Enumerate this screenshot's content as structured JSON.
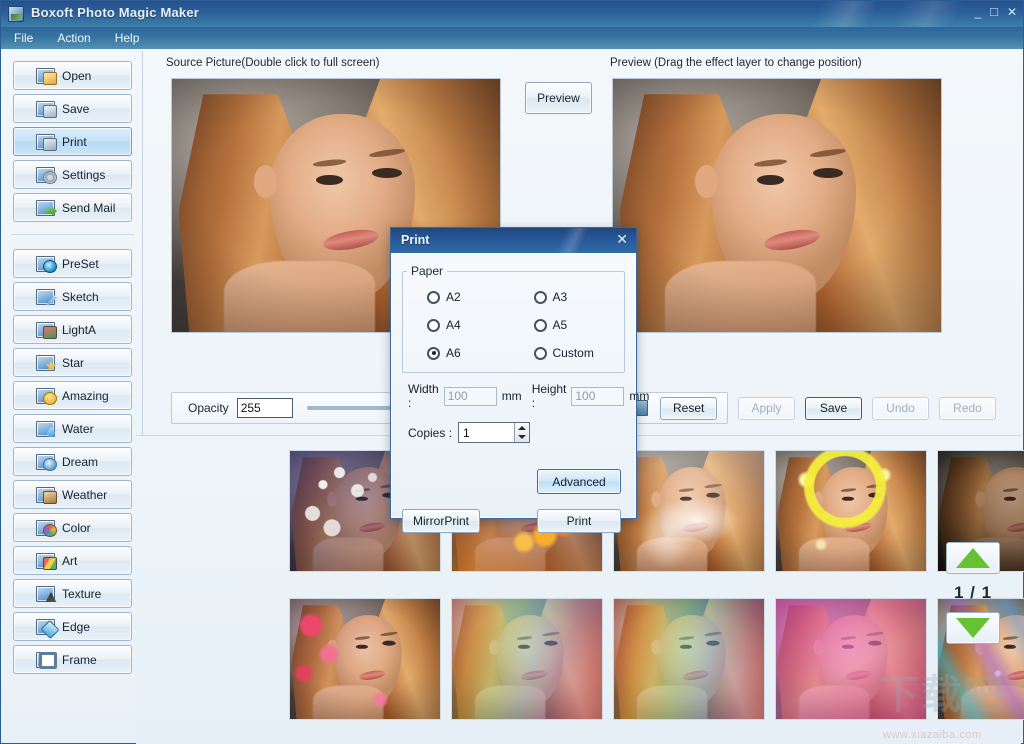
{
  "window": {
    "title": "Boxoft Photo Magic Maker",
    "icon": "app-icon",
    "minimize": "_",
    "maximize": "□",
    "close": "✕"
  },
  "menubar": {
    "items": [
      {
        "label": "File"
      },
      {
        "label": "Action"
      },
      {
        "label": "Help"
      }
    ]
  },
  "sidebar": {
    "group1": [
      {
        "label": "Open",
        "icon": "open-icon",
        "active": false
      },
      {
        "label": "Save",
        "icon": "save-icon",
        "active": false
      },
      {
        "label": "Print",
        "icon": "print-icon",
        "active": true
      },
      {
        "label": "Settings",
        "icon": "settings-icon",
        "active": false
      },
      {
        "label": "Send Mail",
        "icon": "mail-icon",
        "active": false
      }
    ],
    "group2": [
      {
        "label": "PreSet",
        "icon": "preset-icon"
      },
      {
        "label": "Sketch",
        "icon": "sketch-icon"
      },
      {
        "label": "LightA",
        "icon": "lighta-icon"
      },
      {
        "label": "Star",
        "icon": "star-icon"
      },
      {
        "label": "Amazing",
        "icon": "amazing-icon"
      },
      {
        "label": "Water",
        "icon": "water-icon"
      },
      {
        "label": "Dream",
        "icon": "dream-icon"
      },
      {
        "label": "Weather",
        "icon": "weather-icon"
      },
      {
        "label": "Color",
        "icon": "color-icon"
      },
      {
        "label": "Art",
        "icon": "art-icon"
      },
      {
        "label": "Texture",
        "icon": "texture-icon"
      },
      {
        "label": "Edge",
        "icon": "edge-icon"
      },
      {
        "label": "Frame",
        "icon": "frame-icon"
      }
    ]
  },
  "main": {
    "source_label": "Source Picture(Double click to full screen)",
    "preview_label": "Preview (Drag the effect layer to change position)",
    "preview_button": "Preview",
    "opacity": {
      "label": "Opacity",
      "value": "255",
      "slider_position_percent": 100
    },
    "actions": {
      "reset": "Reset",
      "apply": "Apply",
      "save": "Save",
      "undo": "Undo",
      "redo": "Redo",
      "apply_enabled": false,
      "undo_enabled": false,
      "redo_enabled": false
    },
    "pager": {
      "up_icon": "triangle-up-icon",
      "down_icon": "triangle-down-icon",
      "counter": "1 / 1"
    },
    "thumbnails": [
      {
        "effect": "bubbles",
        "overlay": "ov-bubbles"
      },
      {
        "effect": "fire",
        "overlay": "ov-fire"
      },
      {
        "effect": "smoke",
        "overlay": "ov-smoke"
      },
      {
        "effect": "halo",
        "overlay": "ov-halo"
      },
      {
        "effect": "dark",
        "overlay": "ov-dark"
      },
      {
        "effect": "stars",
        "overlay": "ov-stars"
      },
      {
        "effect": "rainbow",
        "overlay": "ov-rainbow"
      },
      {
        "effect": "rainbow2",
        "overlay": "ov-rainbow2"
      },
      {
        "effect": "pink",
        "overlay": "ov-pink"
      },
      {
        "effect": "aurora",
        "overlay": "ov-aurora"
      }
    ]
  },
  "print_dialog": {
    "title": "Print",
    "close_icon": "close-icon",
    "paper_legend": "Paper",
    "paper_options": [
      {
        "label": "A2",
        "checked": false
      },
      {
        "label": "A3",
        "checked": false
      },
      {
        "label": "A4",
        "checked": false
      },
      {
        "label": "A5",
        "checked": false
      },
      {
        "label": "A6",
        "checked": true
      },
      {
        "label": "Custom",
        "checked": false
      }
    ],
    "width_label": "Width :",
    "width_value": "100",
    "width_unit": "mm",
    "height_label": "Height :",
    "height_value": "100",
    "height_unit": "mm",
    "copies_label": "Copies :",
    "copies_value": "1",
    "advanced_button": "Advanced",
    "mirror_button": "MirrorPrint",
    "print_button": "Print"
  },
  "watermark": {
    "text_cn": "下载吧",
    "url": "www.xiazaiba.com"
  }
}
